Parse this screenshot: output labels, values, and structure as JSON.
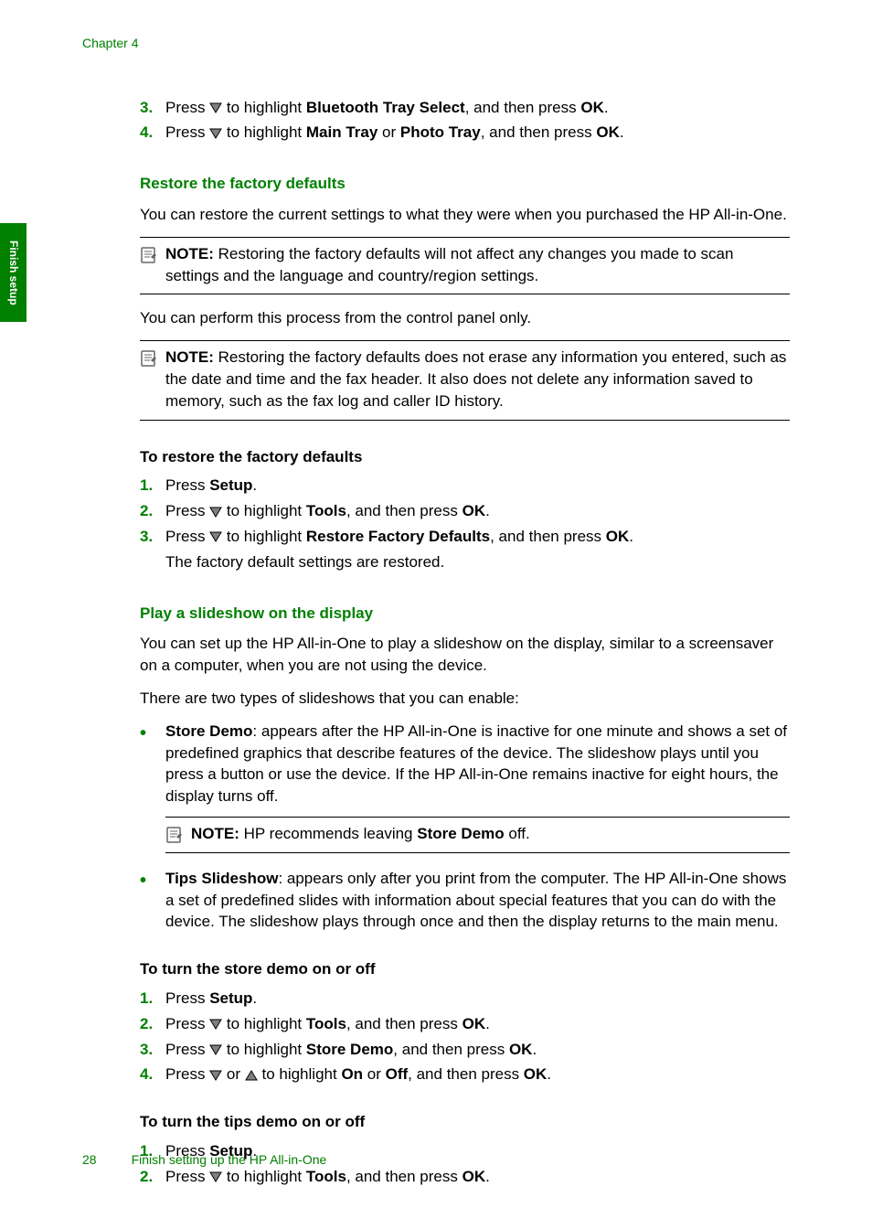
{
  "chapter_header": "Chapter 4",
  "side_tab": "Finish setup",
  "icons": {
    "down": "▼",
    "up": "▲"
  },
  "steps_top": [
    {
      "n": "3.",
      "pre": "Press ",
      "mid": " to highlight ",
      "b1": "Bluetooth Tray Select",
      "post": ", and then press ",
      "b2": "OK",
      "end": "."
    },
    {
      "n": "4.",
      "pre": "Press ",
      "mid": " to highlight ",
      "b1": "Main Tray",
      "join": " or ",
      "b1b": "Photo Tray",
      "post": ", and then press ",
      "b2": "OK",
      "end": "."
    }
  ],
  "section1": {
    "heading": "Restore the factory defaults",
    "para1": "You can restore the current settings to what they were when you purchased the HP All-in-One.",
    "note1_label": "NOTE:",
    "note1": "Restoring the factory defaults will not affect any changes you made to scan settings and the language and country/region settings.",
    "para2": "You can perform this process from the control panel only.",
    "note2_label": "NOTE:",
    "note2": "Restoring the factory defaults does not erase any information you entered, such as the date and time and the fax header. It also does not delete any information saved to memory, such as the fax log and caller ID history.",
    "sub": "To restore the factory defaults",
    "steps": [
      {
        "n": "1.",
        "pre": "Press ",
        "b1": "Setup",
        "end": "."
      },
      {
        "n": "2.",
        "pre": "Press ",
        "mid": " to highlight ",
        "b1": "Tools",
        "post": ", and then press ",
        "b2": "OK",
        "end": "."
      },
      {
        "n": "3.",
        "pre": "Press ",
        "mid": " to highlight ",
        "b1": "Restore Factory Defaults",
        "post": ", and then press ",
        "b2": "OK",
        "end": ".",
        "extra": "The factory default settings are restored."
      }
    ]
  },
  "section2": {
    "heading": "Play a slideshow on the display",
    "para1": "You can set up the HP All-in-One to play a slideshow on the display, similar to a screensaver on a computer, when you are not using the device.",
    "para2": "There are two types of slideshows that you can enable:",
    "bullets": [
      {
        "b": "Store Demo",
        "text": ": appears after the HP All-in-One is inactive for one minute and shows a set of predefined graphics that describe features of the device. The slideshow plays until you press a button or use the device. If the HP All-in-One remains inactive for eight hours, the display turns off.",
        "note_label": "NOTE:",
        "note_pre": "HP recommends leaving ",
        "note_b": "Store Demo",
        "note_post": " off."
      },
      {
        "b": "Tips Slideshow",
        "text": ": appears only after you print from the computer. The HP All-in-One shows a set of predefined slides with information about special features that you can do with the device. The slideshow plays through once and then the display returns to the main menu."
      }
    ],
    "sub1": "To turn the store demo on or off",
    "steps1": [
      {
        "n": "1.",
        "pre": "Press ",
        "b1": "Setup",
        "end": "."
      },
      {
        "n": "2.",
        "pre": "Press ",
        "mid": " to highlight ",
        "b1": "Tools",
        "post": ", and then press ",
        "b2": "OK",
        "end": "."
      },
      {
        "n": "3.",
        "pre": "Press ",
        "mid": " to highlight ",
        "b1": "Store Demo",
        "post": ", and then press ",
        "b2": "OK",
        "end": "."
      },
      {
        "n": "4.",
        "pre": "Press ",
        "mid": " or ",
        "mid2": " to highlight ",
        "b1": "On",
        "join": " or ",
        "b1b": "Off",
        "post": ", and then press ",
        "b2": "OK",
        "end": "."
      }
    ],
    "sub2": "To turn the tips demo on or off",
    "steps2": [
      {
        "n": "1.",
        "pre": "Press ",
        "b1": "Setup",
        "end": "."
      },
      {
        "n": "2.",
        "pre": "Press ",
        "mid": " to highlight ",
        "b1": "Tools",
        "post": ", and then press ",
        "b2": "OK",
        "end": "."
      }
    ]
  },
  "footer": {
    "page": "28",
    "text": "Finish setting up the HP All-in-One"
  }
}
